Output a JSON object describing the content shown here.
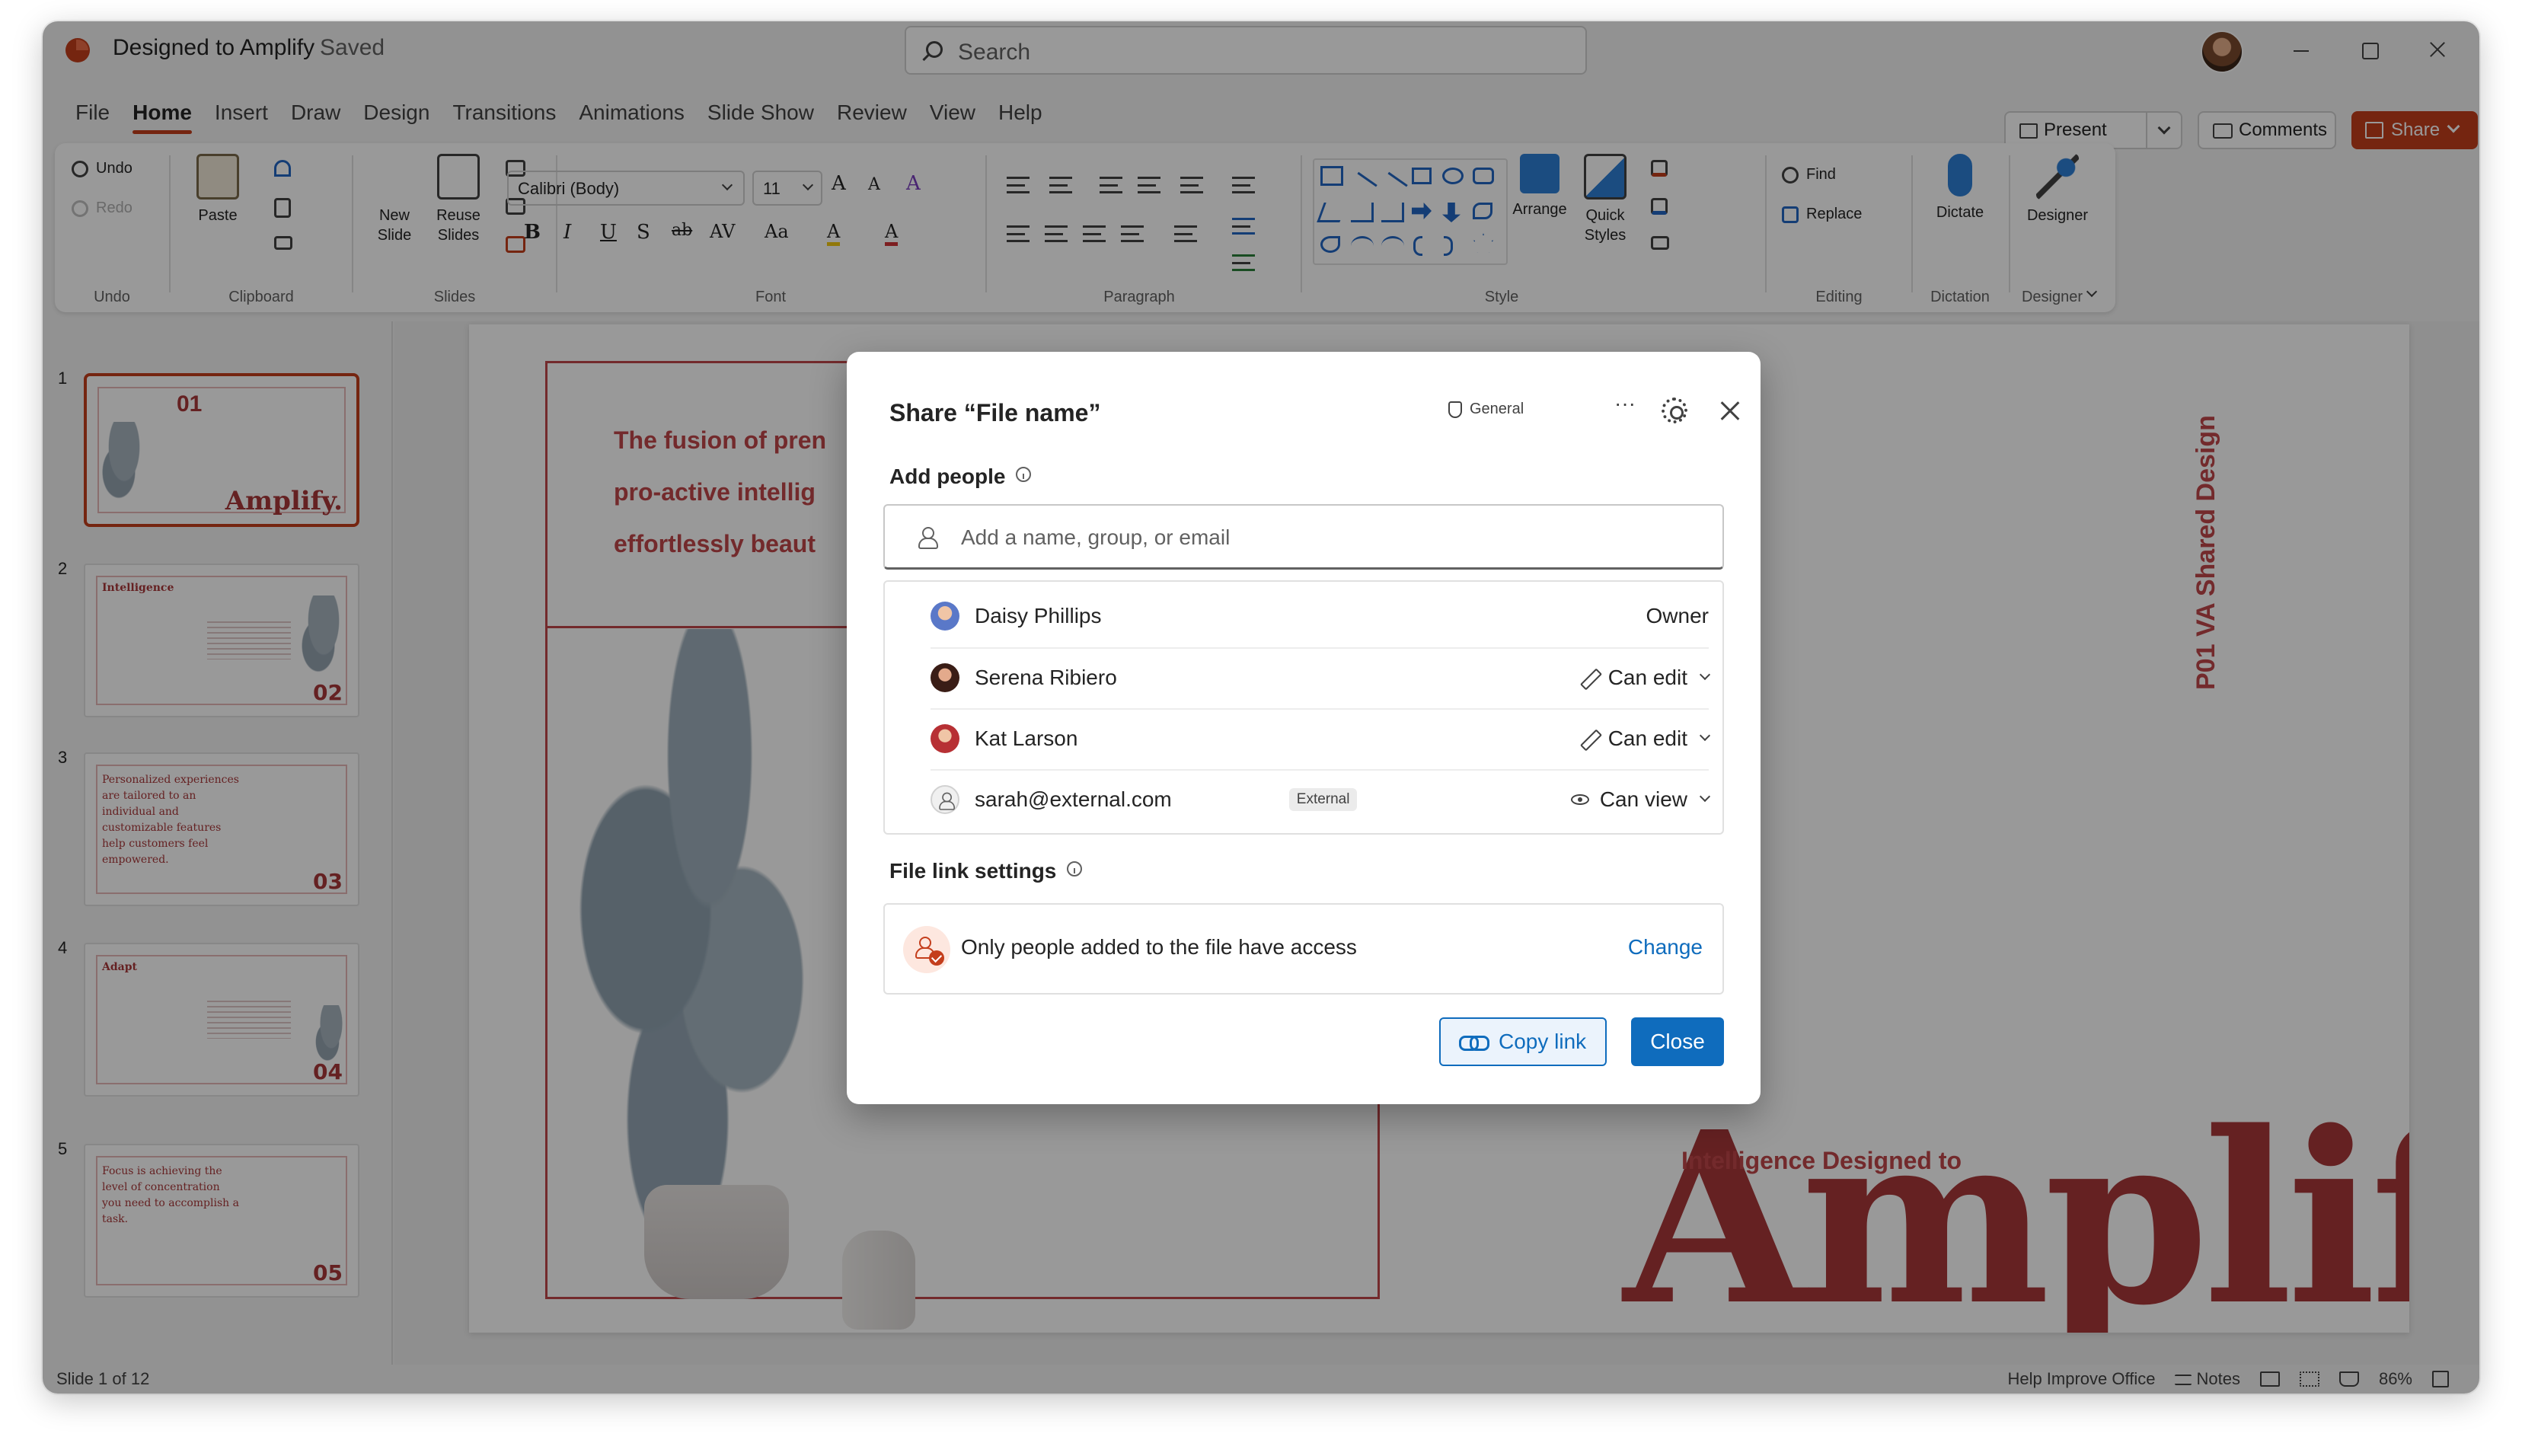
{
  "titlebar": {
    "doc_title": "Designed to Amplify",
    "status": "Saved",
    "search_placeholder": "Search"
  },
  "menu": {
    "tabs": [
      "File",
      "Home",
      "Insert",
      "Draw",
      "Design",
      "Transitions",
      "Animations",
      "Slide Show",
      "Review",
      "View",
      "Help"
    ],
    "active_tab": "Home",
    "present_label": "Present",
    "comments_label": "Comments",
    "share_label": "Share"
  },
  "ribbon": {
    "undo": {
      "undo_label": "Undo",
      "redo_label": "Redo",
      "group": "Undo"
    },
    "clipboard": {
      "paste_label": "Paste",
      "group": "Clipboard"
    },
    "slides": {
      "new_slide_line1": "New",
      "new_slide_line2": "Slide",
      "reuse_line1": "Reuse",
      "reuse_line2": "Slides",
      "group": "Slides"
    },
    "font": {
      "family": "Calibri (Body)",
      "size": "11",
      "bold": "B",
      "italic": "I",
      "underline": "U",
      "strike": "S",
      "spacing": "AV",
      "case": "Aa",
      "grow": "A",
      "shrink": "A",
      "clear": "A",
      "highlight": "A",
      "color": "A",
      "group": "Font"
    },
    "paragraph": {
      "group": "Paragraph"
    },
    "style": {
      "arrange_label": "Arrange",
      "quick_line1": "Quick",
      "quick_line2": "Styles",
      "group": "Style"
    },
    "editing": {
      "find_label": "Find",
      "replace_label": "Replace",
      "group": "Editing"
    },
    "dictation": {
      "dictate_label": "Dictate",
      "group": "Dictation"
    },
    "designer": {
      "designer_label": "Designer",
      "group": "Designer"
    }
  },
  "thumbnails": [
    {
      "num": "1",
      "number_text": "01",
      "title": "",
      "text": "",
      "big": "Amplify."
    },
    {
      "num": "2",
      "number_text": "02",
      "title": "Intelligence",
      "text": "",
      "big": ""
    },
    {
      "num": "3",
      "number_text": "03",
      "title": "",
      "text": "Personalized experiences are tailored to an individual and customizable features help customers feel empowered.",
      "big": ""
    },
    {
      "num": "4",
      "number_text": "04",
      "title": "Adapt",
      "text": "",
      "big": ""
    },
    {
      "num": "5",
      "number_text": "05",
      "title": "",
      "text": "Focus is achieving the level of concentration you need to accomplish a task.",
      "big": ""
    }
  ],
  "slide": {
    "body_line1": "The fusion of pren",
    "body_line2": "pro-active intellig",
    "body_line3": "effortlessly beaut",
    "vertical_text": "P01   VA Shared Design",
    "subhead": "Intelligence Designed to",
    "headline": "Amplify."
  },
  "statusbar": {
    "slide_info": "Slide 1 of 12",
    "help_improve": "Help Improve Office",
    "notes_label": "Notes",
    "zoom": "86%"
  },
  "dialog": {
    "title": "Share “File name”",
    "sensitivity": "General",
    "more_label": "···",
    "add_people_label": "Add people",
    "input_placeholder": "Add a name, group, or email",
    "people": [
      {
        "name": "Daisy Phillips",
        "role": "Owner",
        "badge": ""
      },
      {
        "name": "Serena Ribiero",
        "role": "Can edit",
        "badge": ""
      },
      {
        "name": "Kat Larson",
        "role": "Can edit",
        "badge": ""
      },
      {
        "name": "sarah@external.com",
        "role": "Can view",
        "badge": "External"
      }
    ],
    "link_settings_label": "File link settings",
    "link_access_text": "Only people added to the file have access",
    "change_label": "Change",
    "copy_link_label": "Copy link",
    "close_label": "Close"
  },
  "colors": {
    "brand": "#c43e1c",
    "accent_blue": "#0f6cbd",
    "slide_red": "#a8383a"
  }
}
